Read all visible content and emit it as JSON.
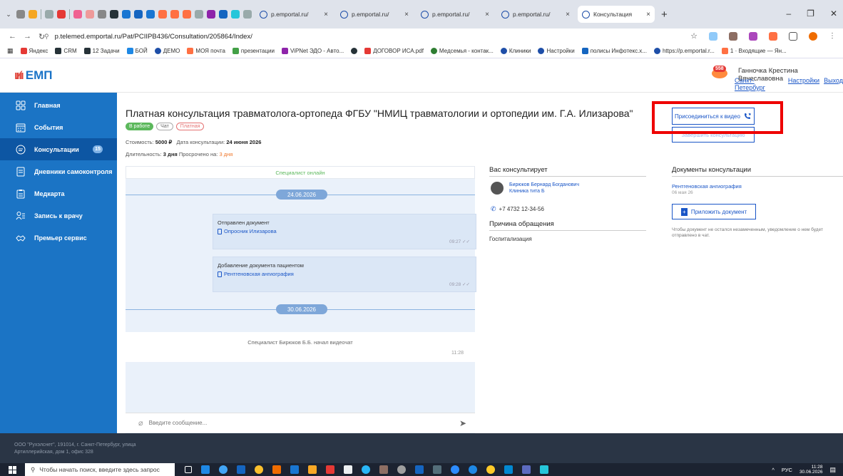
{
  "browser": {
    "tabs": [
      {
        "label": "p.emportal.ru/"
      },
      {
        "label": "p.emportal.ru/"
      },
      {
        "label": "p.emportal.ru/"
      },
      {
        "label": "p.emportal.ru/"
      },
      {
        "label": "Консультация"
      }
    ],
    "url": "p.telemed.emportal.ru/Pat/PCIIPB436/Consultation/205864/Index/",
    "bookmarks": [
      {
        "label": "Яндекс",
        "color": "#e53935"
      },
      {
        "label": "CRM",
        "color": "#263238"
      },
      {
        "label": "12 Задачи",
        "color": "#263238"
      },
      {
        "label": "БОЙ",
        "color": "#1e88e5"
      },
      {
        "label": "ДЕМО",
        "color": "#1e4ea8"
      },
      {
        "label": "МОЯ почта",
        "color": "#ff7043"
      },
      {
        "label": "презентации",
        "color": "#43a047"
      },
      {
        "label": "ViPNet ЭДО - Авто...",
        "color": "#8e24aa"
      },
      {
        "label": "ДОГОВОР ИСА.pdf",
        "color": "#e53935"
      },
      {
        "label": "Медсемья - контак...",
        "color": "#2e7d32"
      },
      {
        "label": "Клиники",
        "color": "#1e4ea8"
      },
      {
        "label": "Настройки",
        "color": "#1e4ea8"
      },
      {
        "label": "полисы Инфотекс.х...",
        "color": "#1565c0"
      },
      {
        "label": "https://p.emportal.r...",
        "color": "#1e4ea8"
      },
      {
        "label": "1 · Входящие — Ян...",
        "color": "#ff7043"
      }
    ]
  },
  "header": {
    "logo_mark": "ıı⁄ıı",
    "logo_text": "ЕМП",
    "notifications_count": "558",
    "user_name": "Ганночка Крестина Вячеславовна",
    "city": "Санкт-Петербург",
    "settings": "Настройки",
    "logout": "Выход"
  },
  "sidebar": {
    "items": [
      {
        "label": "Главная",
        "icon": "grid-icon"
      },
      {
        "label": "События",
        "icon": "calendar-icon"
      },
      {
        "label": "Консультации",
        "icon": "chat-icon",
        "badge": "15",
        "active": true
      },
      {
        "label": "Дневники самоконтроля",
        "icon": "diary-icon"
      },
      {
        "label": "Медкарта",
        "icon": "clipboard-icon"
      },
      {
        "label": "Запись к врачу",
        "icon": "user-list-icon"
      },
      {
        "label": "Премьер сервис",
        "icon": "handshake-icon"
      }
    ]
  },
  "consultation": {
    "title": "Платная консультация травматолога-ортопеда ФГБУ \"НМИЦ травматологии и ортопедии им. Г.А. Илизарова\"",
    "tags": [
      "В работе",
      "Чат",
      "Платная"
    ],
    "cost_label": "Стоимость:",
    "cost_value": "5000 ₽",
    "date_label": "Дата консультации:",
    "date_value": "24 июня 2026",
    "duration_label": "Длительность:",
    "duration_value": "3 дня",
    "overdue_label": "Просрочено на:",
    "overdue_value": "3 дня",
    "join_video": "Присоединиться к видео",
    "end_consult": "Завершить консультацию"
  },
  "chat": {
    "status": "Специалист онлайн",
    "date1": "24.06.2026",
    "messages": [
      {
        "title": "Отправлен документ",
        "link": "Опросник Илизарова",
        "time": "09:27"
      },
      {
        "title": "Добавление документа пациентом",
        "link": "Рентгеновская ангиография",
        "time": "09:28"
      }
    ],
    "date2": "30.06.2026",
    "system_text": "Специалист Бирюков Б.Б. начал видеочат",
    "system_time": "11:28",
    "input_placeholder": "Введите сообщение..."
  },
  "consultant": {
    "title": "Вас консультирует",
    "doctor_name": "Бирюков Бернард Богданович",
    "clinic": "Клиника тита Б",
    "phone": "+7 4732 12-34-56",
    "reason_title": "Причина обращения",
    "reason": "Госпитализация"
  },
  "documents": {
    "title": "Документы консультации",
    "doc_name": "Рентгеновская ангиография",
    "doc_date": "06 мая 26",
    "attach_label": "Приложить документ",
    "note": "Чтобы документ не остался незамеченным, уведомление о нем будет отправлено в чат."
  },
  "footer": {
    "address": "ООО \"Рухэлснет\", 191014, г. Санкт-Петербург, улица Артиллерийская, дом 1, офис 328"
  },
  "taskbar": {
    "search_placeholder": "Чтобы начать поиск, введите здесь запрос",
    "lang": "РУС",
    "time": "11:28",
    "date": "30.06.2026"
  },
  "colors": {
    "sidebar": "#1b74c5",
    "sidebar_active": "#0d56a3",
    "link": "#1a56c7",
    "online": "#5cb85c",
    "highlight": "#ee0000"
  }
}
